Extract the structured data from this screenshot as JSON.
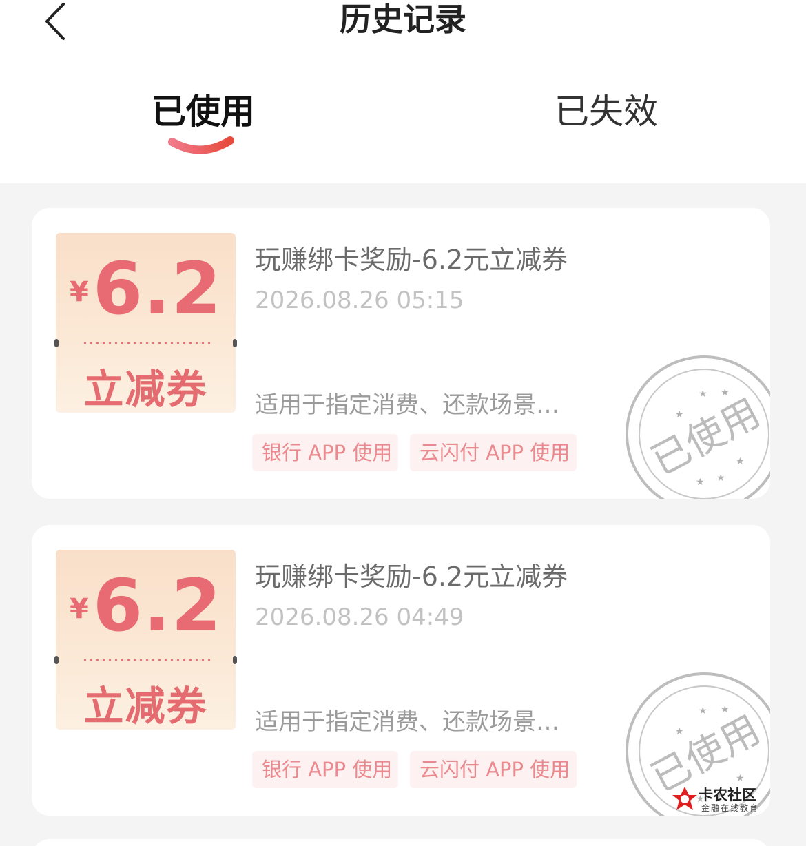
{
  "header": {
    "title": "历史记录",
    "back_icon": "chevron-left-icon"
  },
  "tabs": [
    {
      "label": "已使用",
      "active": true
    },
    {
      "label": "已失效",
      "active": false
    }
  ],
  "colors": {
    "accent_gradient_start": "#f07a8a",
    "accent_gradient_end": "#e84a3c",
    "coupon_red": "#e86a72",
    "stamp_gray": "#b8b8b8"
  },
  "coupons": [
    {
      "currency": "¥",
      "amount": "6.2",
      "type": "立减券",
      "title": "玩赚绑卡奖励-6.2元立减券",
      "time": "2026.08.26 05:15",
      "description": "适用于指定消费、还款场景…",
      "tags": [
        "银行 APP 使用",
        "云闪付 APP 使用"
      ],
      "stamp": "已使用"
    },
    {
      "currency": "¥",
      "amount": "6.2",
      "type": "立减券",
      "title": "玩赚绑卡奖励-6.2元立减券",
      "time": "2026.08.26 04:49",
      "description": "适用于指定消费、还款场景…",
      "tags": [
        "银行 APP 使用",
        "云闪付 APP 使用"
      ],
      "stamp": "已使用"
    }
  ],
  "watermark": {
    "name": "卡农社区",
    "tagline": "金融在线教育"
  }
}
